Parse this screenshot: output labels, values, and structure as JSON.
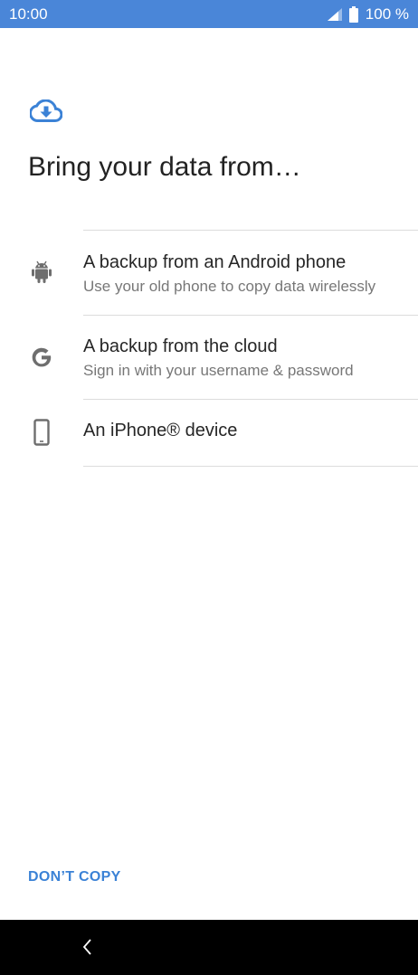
{
  "status_bar": {
    "time": "10:00",
    "battery": "100 %",
    "icons": [
      "signal-icon",
      "battery-icon"
    ],
    "background": "#4a86d8"
  },
  "header": {
    "icon": "cloud-download-icon",
    "title": "Bring your data from…"
  },
  "options": [
    {
      "icon": "android-icon",
      "title": "A backup from an Android phone",
      "subtitle": "Use your old phone to copy data wirelessly"
    },
    {
      "icon": "google-icon",
      "title": "A backup from the cloud",
      "subtitle": "Sign in with your username & password"
    },
    {
      "icon": "phone-icon",
      "title": "An iPhone® device",
      "subtitle": ""
    }
  ],
  "actions": {
    "dont_copy_label": "DON’T COPY",
    "accent": "#3b82d6"
  },
  "nav_bar": {
    "back_icon": "back-chevron-icon"
  }
}
